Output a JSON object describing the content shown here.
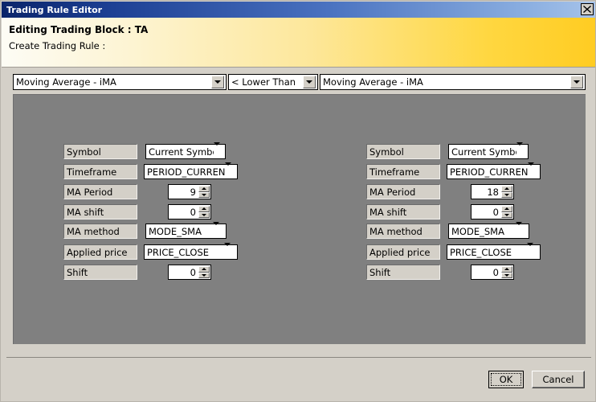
{
  "window": {
    "title": "Trading Rule Editor",
    "close_icon": "close-icon"
  },
  "header": {
    "title": "Editing Trading Block : TA",
    "subtitle": "Create Trading Rule :"
  },
  "rule": {
    "left_indicator": "Moving Average - iMA",
    "operator": "< Lower Than",
    "right_indicator": "Moving Average - iMA"
  },
  "left_panel": {
    "rows": [
      {
        "label": "Symbol",
        "value": "Current Symbol",
        "control": "combo"
      },
      {
        "label": "Timeframe",
        "value": "PERIOD_CURRENT",
        "control": "combo"
      },
      {
        "label": "MA Period",
        "value": "9",
        "control": "spinner"
      },
      {
        "label": "MA shift",
        "value": "0",
        "control": "spinner"
      },
      {
        "label": "MA method",
        "value": "MODE_SMA",
        "control": "combo"
      },
      {
        "label": "Applied price",
        "value": "PRICE_CLOSE",
        "control": "combo"
      },
      {
        "label": "Shift",
        "value": "0",
        "control": "spinner"
      }
    ]
  },
  "right_panel": {
    "rows": [
      {
        "label": "Symbol",
        "value": "Current Symbol",
        "control": "combo"
      },
      {
        "label": "Timeframe",
        "value": "PERIOD_CURRENT",
        "control": "combo"
      },
      {
        "label": "MA Period",
        "value": "18",
        "control": "spinner"
      },
      {
        "label": "MA shift",
        "value": "0",
        "control": "spinner"
      },
      {
        "label": "MA method",
        "value": "MODE_SMA",
        "control": "combo"
      },
      {
        "label": "Applied price",
        "value": "PRICE_CLOSE",
        "control": "combo"
      },
      {
        "label": "Shift",
        "value": "0",
        "control": "spinner"
      }
    ]
  },
  "footer": {
    "ok_label": "OK",
    "cancel_label": "Cancel"
  },
  "colors": {
    "titlebar_start": "#0a246a",
    "titlebar_end": "#a6c3ea",
    "header_start": "#fdfcf5",
    "header_end": "#ffcc22",
    "panel_gray": "#808080",
    "dialog_face": "#d4d0c8"
  }
}
